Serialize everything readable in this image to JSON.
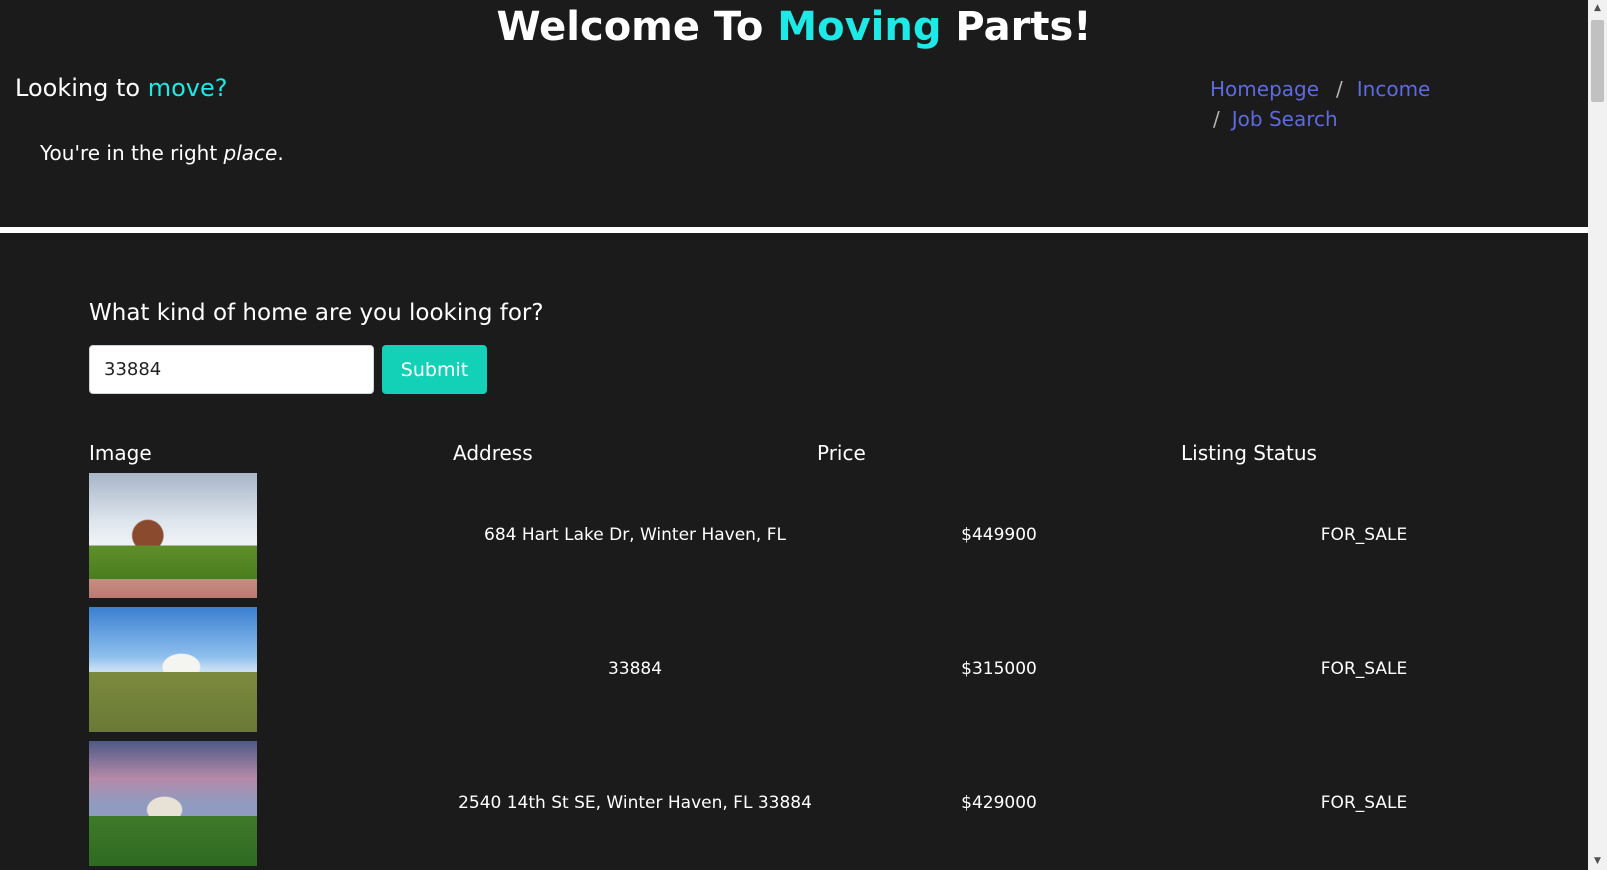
{
  "header": {
    "title_part1": "Welcome To ",
    "title_accent": "Moving",
    "title_part2": " Parts!",
    "tagline_part1": "Looking to ",
    "tagline_accent": "move?",
    "subtag_part1": "You're in the right ",
    "subtag_emph": "place",
    "subtag_part2": "."
  },
  "nav": {
    "homepage": "Homepage",
    "income": "Income",
    "job_search": "Job Search",
    "separator": "/"
  },
  "search": {
    "question": "What kind of home are you looking for?",
    "value": "33884",
    "submit_label": "Submit"
  },
  "table": {
    "headers": {
      "image": "Image",
      "address": "Address",
      "price": "Price",
      "status": "Listing Status"
    },
    "rows": [
      {
        "address": "684 Hart Lake Dr, Winter Haven, FL",
        "price": "$449900",
        "status": "FOR_SALE",
        "image_icon": "house-photo"
      },
      {
        "address": "33884",
        "price": "$315000",
        "status": "FOR_SALE",
        "image_icon": "house-photo"
      },
      {
        "address": "2540 14th St SE, Winter Haven, FL 33884",
        "price": "$429000",
        "status": "FOR_SALE",
        "image_icon": "house-photo"
      }
    ]
  },
  "colors": {
    "background": "#1b1b1b",
    "accent": "#1de9e6",
    "link": "#5e6ae0",
    "submit": "#12d1b6"
  }
}
